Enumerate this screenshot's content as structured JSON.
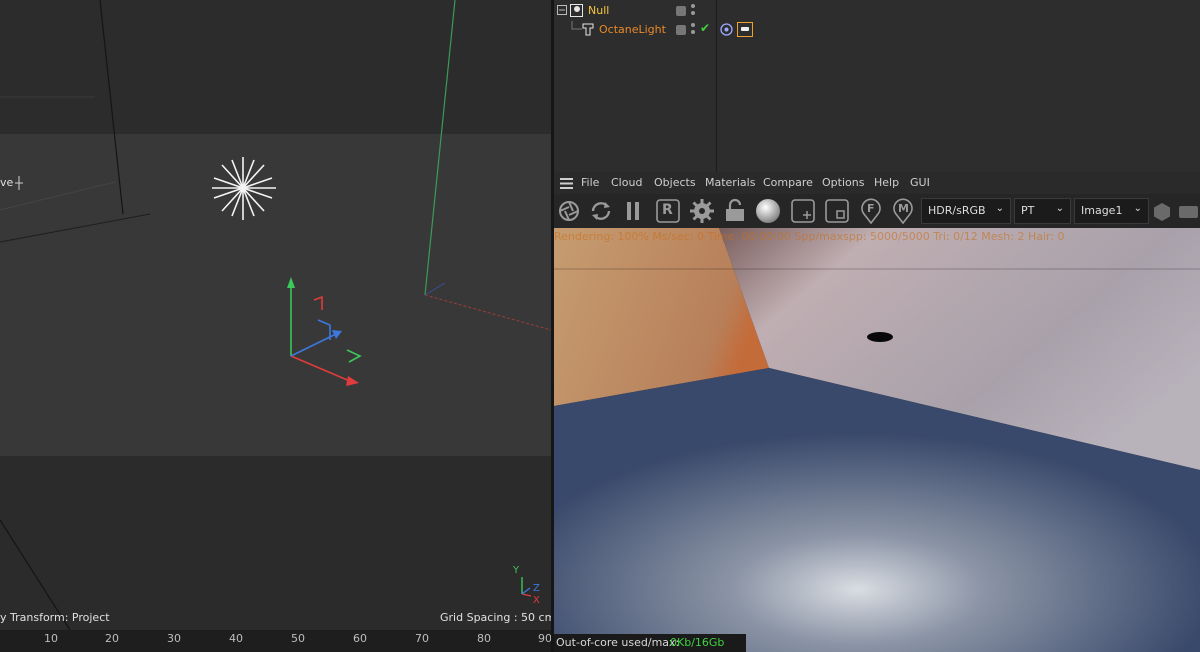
{
  "viewport": {
    "left_partial_label": "ve",
    "transform_label": "y Transform: Project",
    "grid_spacing": "Grid Spacing : 50 cm",
    "axis_labels": {
      "y": "Y",
      "z": "Z",
      "x": "X"
    },
    "ruler_ticks": [
      "10",
      "20",
      "30",
      "40",
      "50",
      "60",
      "70",
      "80",
      "90"
    ]
  },
  "object_manager": {
    "objects": [
      {
        "name": "Null",
        "color": "#f5c542",
        "icon": "null-object-icon",
        "expanded": true
      },
      {
        "name": "OctaneLight",
        "color": "#e8892a",
        "icon": "octane-light-icon",
        "enabled_check": "✔"
      }
    ]
  },
  "octane": {
    "menu": [
      "File",
      "Cloud",
      "Objects",
      "Materials",
      "Compare",
      "Options",
      "Help",
      "GUI"
    ],
    "toolbar_icons": [
      "send-scene-icon",
      "restart-render-icon",
      "pause-icon",
      "region-render-icon",
      "settings-gear-icon",
      "lock-icon",
      "material-ball-icon",
      "add-region-icon",
      "region-icon",
      "focus-picker-icon",
      "material-picker-icon"
    ],
    "toolbar_letters": {
      "region": "R",
      "focus": "F",
      "material": "M"
    },
    "colorspace": "HDR/sRGB",
    "kernel": "PT",
    "image_slot": "Image1",
    "status_line": "Rendering: 100%  Ms/sec: 0  Time: 00:00:00  Spp/maxspp: 5000/5000  Tri: 0/12  Mesh: 2  Hair: 0",
    "ooc_label": "Out-of-core used/max:",
    "ooc_value": "0Kb/16Gb",
    "accent_color": "#f0a030",
    "ooc_value_color": "#3fd13f"
  }
}
